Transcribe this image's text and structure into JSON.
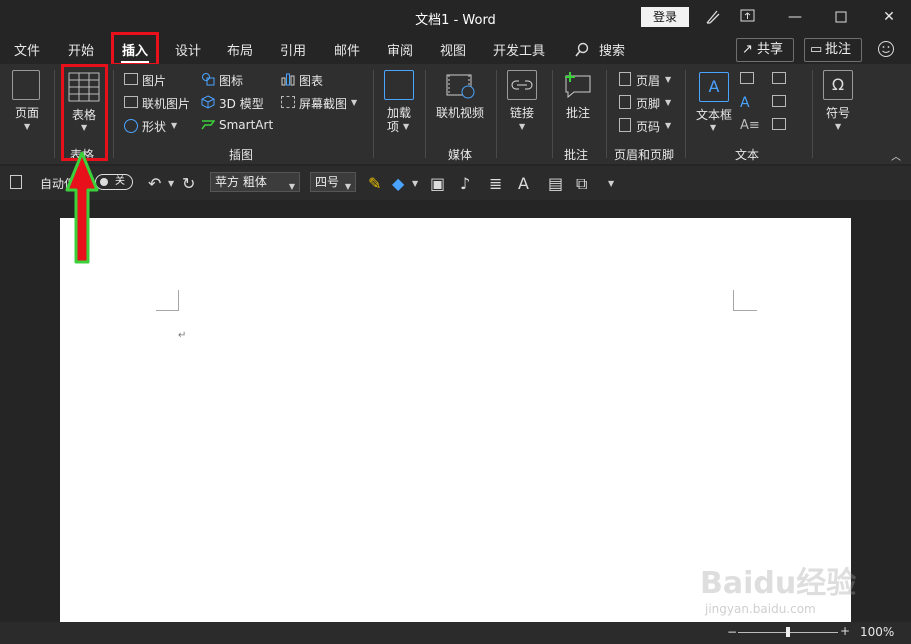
{
  "window": {
    "title": "文档1  -  Word",
    "login_label": "登录",
    "minimize": "—",
    "restore": "▫",
    "close": "✕"
  },
  "menu": {
    "items": [
      "文件",
      "开始",
      "插入",
      "设计",
      "布局",
      "引用",
      "邮件",
      "审阅",
      "视图",
      "开发工具"
    ],
    "active": "插入",
    "search_label": "搜索",
    "share_label": "共享",
    "comment_label": "批注"
  },
  "ribbon": {
    "pages": {
      "label": "页面",
      "group": ""
    },
    "table": {
      "label": "表格",
      "group": "表格"
    },
    "illustrations": {
      "group": "插图",
      "picture": "图片",
      "online_picture": "联机图片",
      "shapes": "形状",
      "icons": "图标",
      "models_3d": "3D 模型",
      "smartart": "SmartArt",
      "chart": "图表",
      "screenshot": "屏幕截图"
    },
    "addins": {
      "label_line1": "加载",
      "label_line2": "项"
    },
    "media": {
      "online_video": "联机视频",
      "group": "媒体"
    },
    "links": {
      "label": "链接"
    },
    "comments": {
      "label": "批注",
      "group": "批注"
    },
    "header_footer": {
      "header": "页眉",
      "footer": "页脚",
      "page_number": "页码",
      "group": "页眉和页脚"
    },
    "text": {
      "textbox": "文本框",
      "group": "文本"
    },
    "symbols": {
      "label": "符号"
    }
  },
  "qat": {
    "autosave_label": "自动保",
    "toggle_label": "关",
    "font_name": "苹方 粗体",
    "font_size": "四号"
  },
  "document": {
    "paragraph_mark": "↵"
  },
  "status": {
    "zoom": "100%"
  },
  "watermark": {
    "main": "Baidu经验",
    "sub": "jingyan.baidu.com"
  },
  "colors": {
    "highlight": "#e8101a",
    "arrow_fill": "#e8101a",
    "arrow_outline": "#3ad13a"
  }
}
